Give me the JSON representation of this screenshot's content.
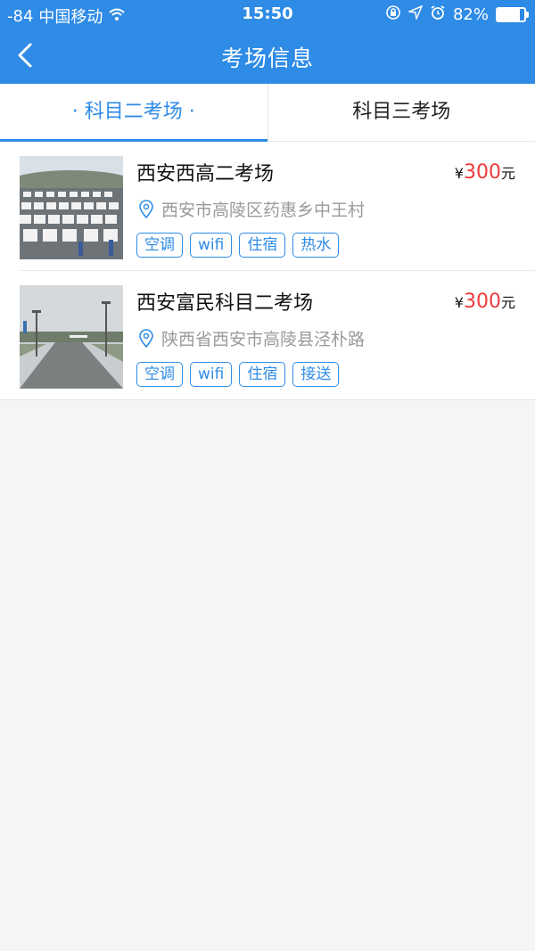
{
  "status_bar": {
    "signal": "-84",
    "carrier": "中国移动",
    "time": "15:50",
    "battery": "82%",
    "battery_level": 0.82
  },
  "nav": {
    "title": "考场信息"
  },
  "tabs": [
    {
      "label": "· 科目二考场 ·",
      "active": true
    },
    {
      "label": "科目三考场",
      "active": false
    }
  ],
  "items": [
    {
      "name": "西安西高二考场",
      "currency": "¥",
      "price": "300",
      "unit": "元",
      "address": "西安市高陵区药惠乡中王村",
      "tags": [
        "空调",
        "wifi",
        "住宿",
        "热水"
      ]
    },
    {
      "name": "西安富民科目二考场",
      "currency": "¥",
      "price": "300",
      "unit": "元",
      "address": "陕西省西安市高陵县泾朴路",
      "tags": [
        "空调",
        "wifi",
        "住宿",
        "接送"
      ]
    }
  ],
  "colors": {
    "primary": "#2e8be6",
    "price": "#ee3b3b"
  }
}
